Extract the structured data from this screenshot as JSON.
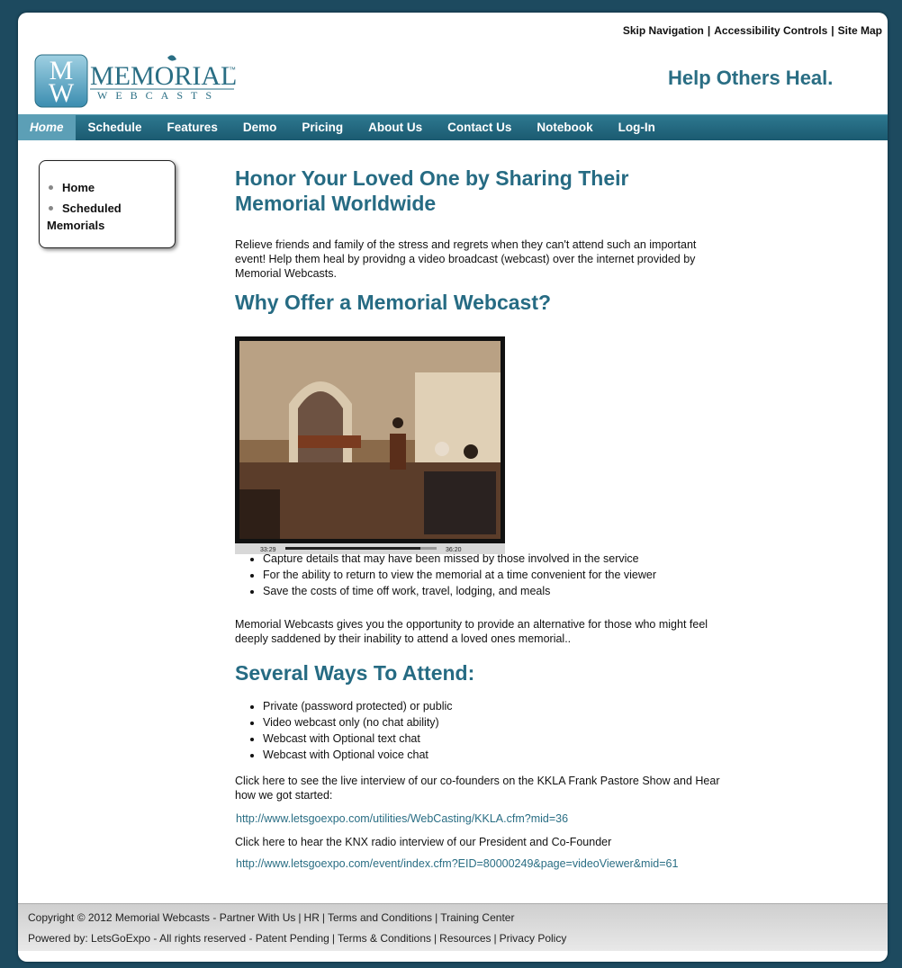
{
  "toplinks": {
    "skip": "Skip Navigation",
    "access": "Accessibility Controls",
    "sitemap": "Site Map",
    "sep": "|"
  },
  "logo": {
    "word1": "MEMORIAL",
    "tm": "™",
    "word2": "WEBCASTS",
    "brand_color": "#2a6e84"
  },
  "tagline": "Help Others Heal.",
  "nav": [
    {
      "label": "Home"
    },
    {
      "label": "Schedule"
    },
    {
      "label": "Features"
    },
    {
      "label": "Demo"
    },
    {
      "label": "Pricing"
    },
    {
      "label": "About Us"
    },
    {
      "label": "Contact Us"
    },
    {
      "label": "Notebook"
    },
    {
      "label": "Log-In"
    }
  ],
  "sidebar": {
    "items": [
      {
        "label": "Home"
      },
      {
        "label": "Scheduled Memorials"
      }
    ]
  },
  "main": {
    "h1": "Honor Your Loved One by Sharing Their Memorial Worldwide",
    "intro": "Relieve friends and family of the stress and regrets when they can't attend such an important event! Help them heal by providng a video broadcast (webcast) over the internet provided by Memorial Webcasts.",
    "h2a": "Why Offer a Memorial Webcast?",
    "video": {
      "elapsed": "33:29",
      "total": "36:20",
      "progress": 0.92
    },
    "bullets1": [
      "Capture details that may have been missed by those involved in the service",
      "For the ability to return to view the memorial at a time convenient for the viewer",
      "Save the costs of time off work, travel, lodging, and meals"
    ],
    "para2": "Memorial Webcasts gives you the opportunity to provide an alternative for those who might feel deeply saddened by their inability to attend a loved ones memorial..",
    "h2b": "Several Ways To Attend:",
    "bullets2": [
      "Private (password protected) or public",
      "Video webcast only (no chat ability)",
      "Webcast with Optional text chat",
      "Webcast with Optional voice chat"
    ],
    "kkla_text": "Click here to see the live interview of our co-founders on the KKLA Frank Pastore Show and Hear how we got started:",
    "kkla_link": "http://www.letsgoexpo.com/utilities/WebCasting/KKLA.cfm?mid=36",
    "knx_text": "Click here to hear the KNX radio interview of our President and Co-Founder",
    "knx_link": "http://www.letsgoexpo.com/event/index.cfm?EID=80000249&page=videoViewer&mid=61"
  },
  "footer": {
    "line1": {
      "copy": "Copyright © 2012 Memorial Webcasts",
      "dash": " - ",
      "partner": "Partner With Us",
      "hr": "HR",
      "terms": "Terms and Conditions",
      "training": "Training Center"
    },
    "line2": {
      "powered": "Powered by: LetsGoExpo",
      "rights": " - All rights reserved - Patent Pending",
      "terms": "Terms & Conditions",
      "resources": "Resources",
      "privacy": "Privacy Policy"
    }
  }
}
